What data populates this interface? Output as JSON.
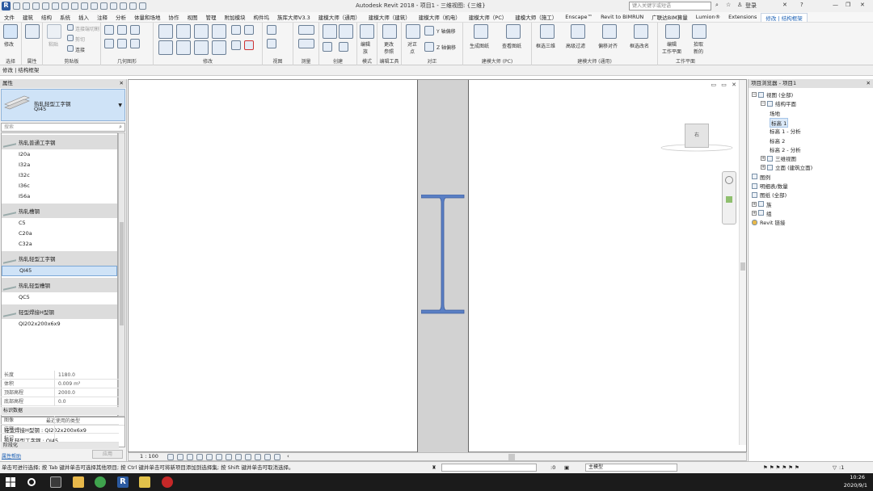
{
  "titlebar": {
    "title": "Autodesk Revit 2018 -    项目1 - 三维视图: {三维}",
    "search_placeholder": "键入关键字或短语",
    "login": "登录",
    "help": "?"
  },
  "menu": [
    "文件",
    "建筑",
    "结构",
    "系统",
    "插入",
    "注释",
    "分析",
    "体量和场地",
    "协作",
    "视图",
    "管理",
    "附加模块",
    "构件坞",
    "族库大师V3.3",
    "建模大师（通用）",
    "建模大师（建筑）",
    "建模大师（机电）",
    "建模大师（PC）",
    "建模大师（施工）",
    "Enscape™",
    "Revit to BIMRUN",
    "广联达BIM算量",
    "Lumion®",
    "Extensions",
    "修改 | 结构框架"
  ],
  "ribbon": {
    "modify": "修改",
    "properties": "属性",
    "paste": "粘贴",
    "clipboard_items": [
      "连接端切割",
      "剪切",
      "连接"
    ],
    "groups": [
      "选择",
      "属性",
      "剪贴板",
      "几何图形",
      "修改",
      "视图",
      "测量",
      "创建",
      "模式",
      "编辑工具",
      "对正",
      "建模大师 (PC)",
      "建模大师 (通用)",
      "工作平面"
    ],
    "mode_btn": "编辑\n族",
    "edit_btn": "更改\n参照",
    "justify_btn": "对正\n点",
    "y_offset": "Y 轴偏移",
    "z_offset": "Z 轴偏移",
    "gen_drawing": "生成图纸",
    "view_drawing": "查看图纸",
    "pc_items": [
      "框选三维",
      "高级过滤",
      "偏移对齐",
      "框选改名"
    ],
    "edit_plane": "编辑\n工作平面",
    "pick_new": "拾取\n新的"
  },
  "options_bar": "修改 | 结构框架",
  "properties": {
    "title": "属性",
    "family": "热轧轻型工字钢",
    "type": "QI45",
    "search_placeholder": "搜索",
    "families": [
      {
        "name": "热轧普通工字钢",
        "types": [
          "I20a",
          "I32a",
          "I32c",
          "I36c",
          "I56a"
        ]
      },
      {
        "name": "热轧槽钢",
        "types": [
          "C5",
          "C20a",
          "C32a"
        ]
      },
      {
        "name": "热轧轻型工字钢",
        "types": [
          "QI45"
        ]
      },
      {
        "name": "热轧轻型槽钢",
        "types": [
          "QC5"
        ]
      },
      {
        "name": "轻型焊接H型钢",
        "types": [
          "QI202x200x6x9"
        ]
      }
    ],
    "selected_type": "QI45",
    "recent_title": "最近使用的类型",
    "recent": [
      "轻型焊接H型钢 : QI202x200x6x9",
      "热轧轻型工字钢 : QI45"
    ],
    "params": [
      {
        "k": "长度",
        "v": "1180.0"
      },
      {
        "k": "体积",
        "v": "0.009 m³"
      },
      {
        "k": "顶部高程",
        "v": "2000.0"
      },
      {
        "k": "底部高程",
        "v": "0.0"
      }
    ],
    "section_id": "标识数据",
    "id_rows": [
      "图像",
      "注释",
      "标记"
    ],
    "section_phase": "阶段化",
    "help_link": "属性帮助",
    "apply": "应用"
  },
  "canvas": {
    "controls": "▭ ▭ ✕",
    "viewcube": "右",
    "scale": "1 : 100"
  },
  "browser": {
    "title": "项目浏览器 - 项目1",
    "tree": [
      {
        "label": "视图 (全部)",
        "depth": 0,
        "toggle": "−"
      },
      {
        "label": "结构平面",
        "depth": 1,
        "toggle": "−"
      },
      {
        "label": "场地",
        "depth": 2
      },
      {
        "label": "标高 1",
        "depth": 2,
        "selected": true
      },
      {
        "label": "标高 1 - 分析",
        "depth": 2
      },
      {
        "label": "标高 2",
        "depth": 2
      },
      {
        "label": "标高 2 - 分析",
        "depth": 2
      },
      {
        "label": "三维视图",
        "depth": 1,
        "toggle": "+"
      },
      {
        "label": "立面 (建筑立面)",
        "depth": 1,
        "toggle": "+"
      },
      {
        "label": "图例",
        "depth": 0
      },
      {
        "label": "明细表/数量",
        "depth": 0
      },
      {
        "label": "图纸 (全部)",
        "depth": 0
      },
      {
        "label": "族",
        "depth": 0,
        "toggle": "+"
      },
      {
        "label": "组",
        "depth": 0,
        "toggle": "+"
      },
      {
        "label": "Revit 链接",
        "depth": 0,
        "link": true
      }
    ]
  },
  "statusbar": {
    "text": "单击可进行选择; 按 Tab 键并单击可选择其他项目; 按 Ctrl 键并单击可将新项目添加到选择集; 按 Shift 键并单击可取消选择。",
    "zero": ":0",
    "model": "主模型",
    "filter_count": ":1"
  },
  "taskbar": {
    "time": "10:26",
    "date": "2020/9/1"
  },
  "colors": {
    "beam_fill": "#5a7fc4",
    "selection": "#cfe3f7",
    "accent": "#1a5fb4"
  }
}
